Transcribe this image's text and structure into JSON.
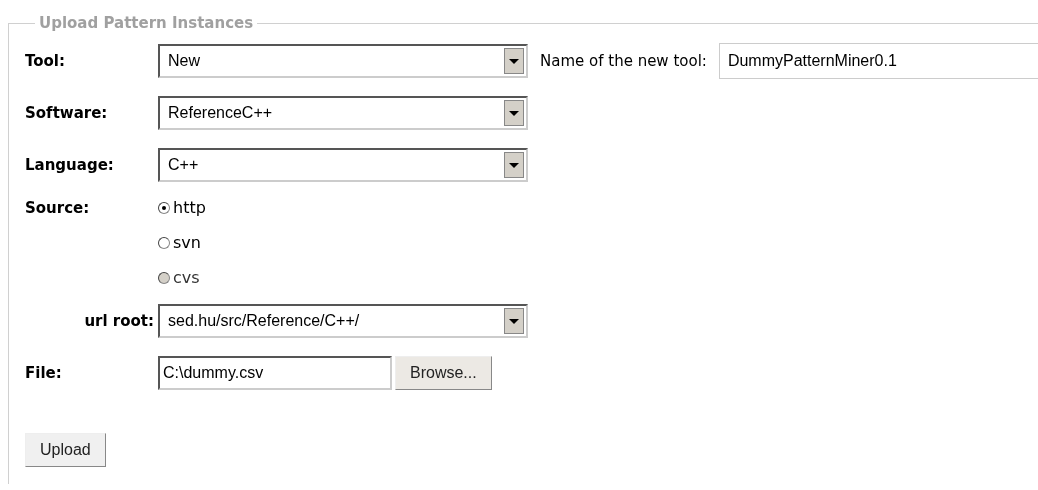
{
  "legend": "Upload Pattern Instances",
  "tool": {
    "label": "Tool:",
    "value": "New",
    "new_name_label": "Name of the new tool:",
    "new_name_value": "DummyPatternMiner0.1"
  },
  "software": {
    "label": "Software:",
    "value": "ReferenceC++"
  },
  "language": {
    "label": "Language:",
    "value": "C++"
  },
  "source": {
    "label": "Source:",
    "options": [
      {
        "label": "http",
        "selected": true,
        "disabled": false
      },
      {
        "label": "svn",
        "selected": false,
        "disabled": false
      },
      {
        "label": "cvs",
        "selected": false,
        "disabled": true
      }
    ]
  },
  "url_root": {
    "label": "url root:",
    "value": "sed.hu/src/Reference/C++/"
  },
  "file": {
    "label": "File:",
    "value": "C:\\dummy.csv",
    "browse_label": "Browse..."
  },
  "upload_label": "Upload"
}
